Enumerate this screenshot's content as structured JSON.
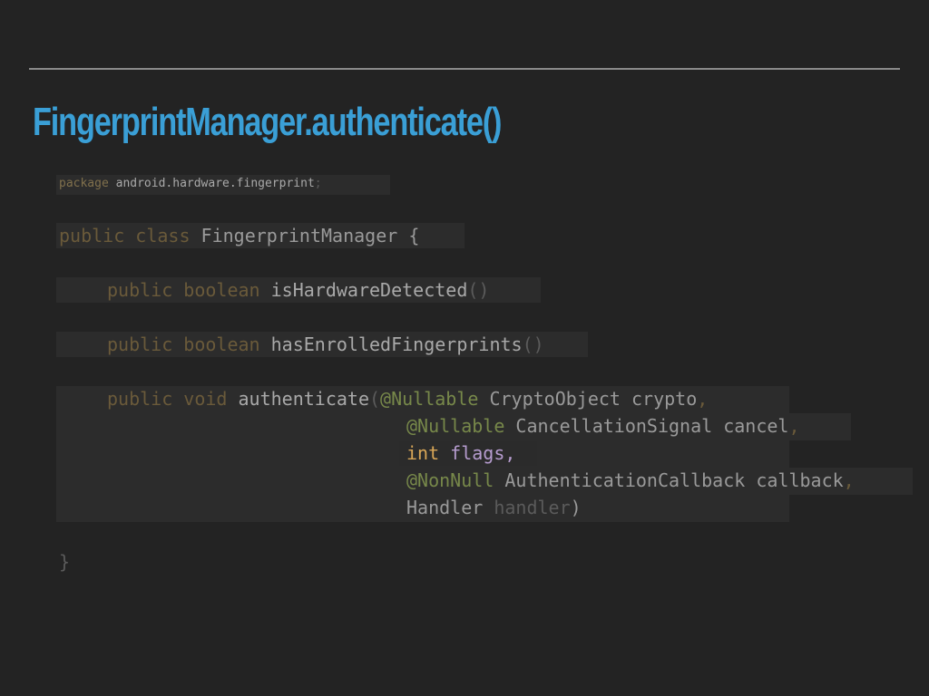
{
  "slide": {
    "title": "FingerprintManager.authenticate()"
  },
  "code": {
    "package_kw": "package",
    "package_name": "android.hardware.fingerprint",
    "package_semi": ";",
    "class_mods": "public class",
    "class_name": "FingerprintManager",
    "class_open": "{",
    "m1_mods": "public boolean",
    "m1_name": "isHardwareDetected",
    "m1_parens": "()",
    "m2_mods": "public boolean",
    "m2_name": "hasEnrolledFingerprints",
    "m2_parens": "()",
    "m3_mods": "public void",
    "m3_name": "authenticate",
    "m3_open": "(",
    "p1_ann": "@Nullable",
    "p1_decl": "CryptoObject crypto",
    "p1_comma": ",",
    "p2_ann": "@Nullable",
    "p2_decl": "CancellationSignal cancel",
    "p2_comma": ",",
    "p3_type": "int",
    "p3_decl": "flags,",
    "p4_ann": "@NonNull",
    "p4_decl": "AuthenticationCallback callback",
    "p4_comma": ",",
    "p5_type": "Handler",
    "p5_name": "handler",
    "p5_close": ")",
    "class_close": "}"
  }
}
